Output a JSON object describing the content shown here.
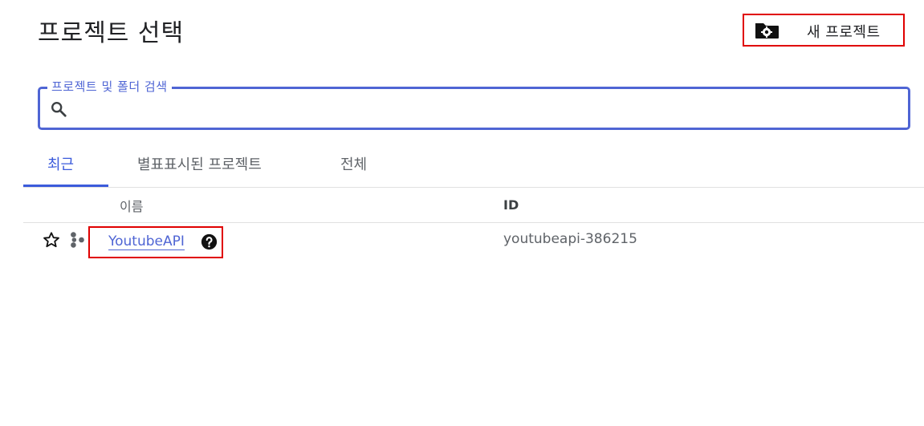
{
  "header": {
    "title": "프로젝트 선택",
    "new_project_label": "새 프로젝트"
  },
  "search": {
    "label": "프로젝트 및 폴더 검색",
    "value": ""
  },
  "tabs": [
    {
      "label": "최근",
      "active": true
    },
    {
      "label": "별표표시된 프로젝트",
      "active": false
    },
    {
      "label": "전체",
      "active": false
    }
  ],
  "table": {
    "columns": {
      "name": "이름",
      "id": "ID"
    },
    "rows": [
      {
        "name": "YoutubeAPI",
        "id": "youtubeapi-386215"
      }
    ]
  },
  "colors": {
    "accent": "#4f65d4",
    "tab_active": "#3b5bdb",
    "highlight_box": "#e00000",
    "muted_text": "#5f6368"
  },
  "icons": {
    "new_project": "folder-gear-icon",
    "search": "search-icon",
    "star": "star-outline-icon",
    "organization": "organization-icon",
    "help": "help-circle-icon"
  }
}
